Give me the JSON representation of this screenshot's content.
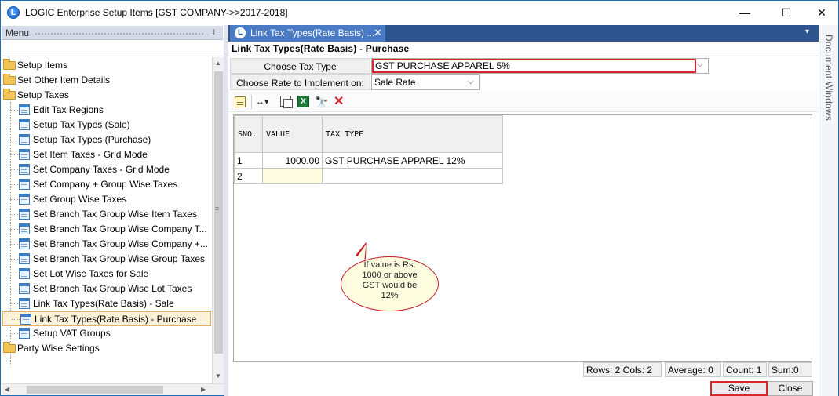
{
  "window": {
    "title": "LOGIC Enterprise Setup Items  [GST COMPANY->>2017-2018]",
    "minimize_glyph": "—",
    "maximize_glyph": "☐",
    "close_glyph": "✕"
  },
  "menu": {
    "header": "Menu",
    "pin_glyph": "⊥",
    "items": [
      {
        "label": "Setup Items",
        "type": "folder",
        "level": 0
      },
      {
        "label": "Set Other Item Details",
        "type": "folder",
        "level": 0
      },
      {
        "label": "Setup Taxes",
        "type": "folder",
        "level": 0
      },
      {
        "label": "Edit Tax Regions",
        "type": "form",
        "level": 1
      },
      {
        "label": "Setup Tax Types (Sale)",
        "type": "form",
        "level": 1
      },
      {
        "label": "Setup Tax Types (Purchase)",
        "type": "form",
        "level": 1
      },
      {
        "label": "Set Item Taxes - Grid Mode",
        "type": "form",
        "level": 1
      },
      {
        "label": "Set Company Taxes - Grid Mode",
        "type": "form",
        "level": 1
      },
      {
        "label": "Set Company + Group Wise Taxes",
        "type": "form",
        "level": 1
      },
      {
        "label": "Set Group Wise Taxes",
        "type": "form",
        "level": 1
      },
      {
        "label": "Set Branch Tax Group Wise Item Taxes",
        "type": "form",
        "level": 1
      },
      {
        "label": "Set Branch Tax Group Wise Company T...",
        "type": "form",
        "level": 1
      },
      {
        "label": "Set Branch Tax Group Wise Company +...",
        "type": "form",
        "level": 1
      },
      {
        "label": "Set Branch Tax Group Wise Group Taxes",
        "type": "form",
        "level": 1
      },
      {
        "label": "Set Lot Wise Taxes for Sale",
        "type": "form",
        "level": 1
      },
      {
        "label": "Set Branch Tax Group Wise Lot Taxes",
        "type": "form",
        "level": 1
      },
      {
        "label": "Link Tax Types(Rate Basis) - Sale",
        "type": "form",
        "level": 1
      },
      {
        "label": "Link Tax Types(Rate Basis) - Purchase",
        "type": "form",
        "level": 1,
        "selected": true
      },
      {
        "label": "Setup VAT Groups",
        "type": "form",
        "level": 1
      },
      {
        "label": "Party Wise Settings",
        "type": "folder",
        "level": 0
      }
    ]
  },
  "scroll": {
    "up": "▲",
    "down": "▼",
    "left": "◀",
    "right": "▶",
    "grip": "≡"
  },
  "tab": {
    "label": "Link Tax Types(Rate Basis) ...",
    "close_glyph": "✕",
    "dropdown_glyph": "▾",
    "icon_letter": "L"
  },
  "side_panel": {
    "label": "Document Windows"
  },
  "form": {
    "title": "Link Tax Types(Rate Basis) - Purchase",
    "tax_type_label": "Choose Tax Type",
    "tax_type_value": "GST PURCHASE APPAREL 5%",
    "rate_label": "Choose Rate to Implement on:",
    "rate_value": "Sale Rate",
    "dropdown_glyph": "⌵"
  },
  "toolbar": {
    "width_glyph": "↔▾",
    "excel_letter": "X",
    "find_glyph": "🔭",
    "delete_glyph": "✕"
  },
  "grid": {
    "headers": [
      "SNO.",
      "VALUE",
      "TAX TYPE"
    ],
    "rows": [
      {
        "sno": "1",
        "value": "1000.00",
        "tax_type": "GST PURCHASE APPAREL 12%"
      },
      {
        "sno": "2",
        "value": "",
        "tax_type": ""
      }
    ]
  },
  "callout": {
    "text": "If value is Rs. 1000 or above GST would be 12%"
  },
  "status": {
    "rows_cols": "Rows: 2  Cols: 2",
    "average": "Average: 0",
    "count": "Count: 1",
    "sum": "Sum:0"
  },
  "buttons": {
    "save": "Save",
    "close": "Close"
  },
  "colors": {
    "highlight_border": "#d9262a",
    "tab_active": "#4a7bc4",
    "tab_strip": "#2f5590",
    "selected_item_bg": "#fdf1d8"
  }
}
